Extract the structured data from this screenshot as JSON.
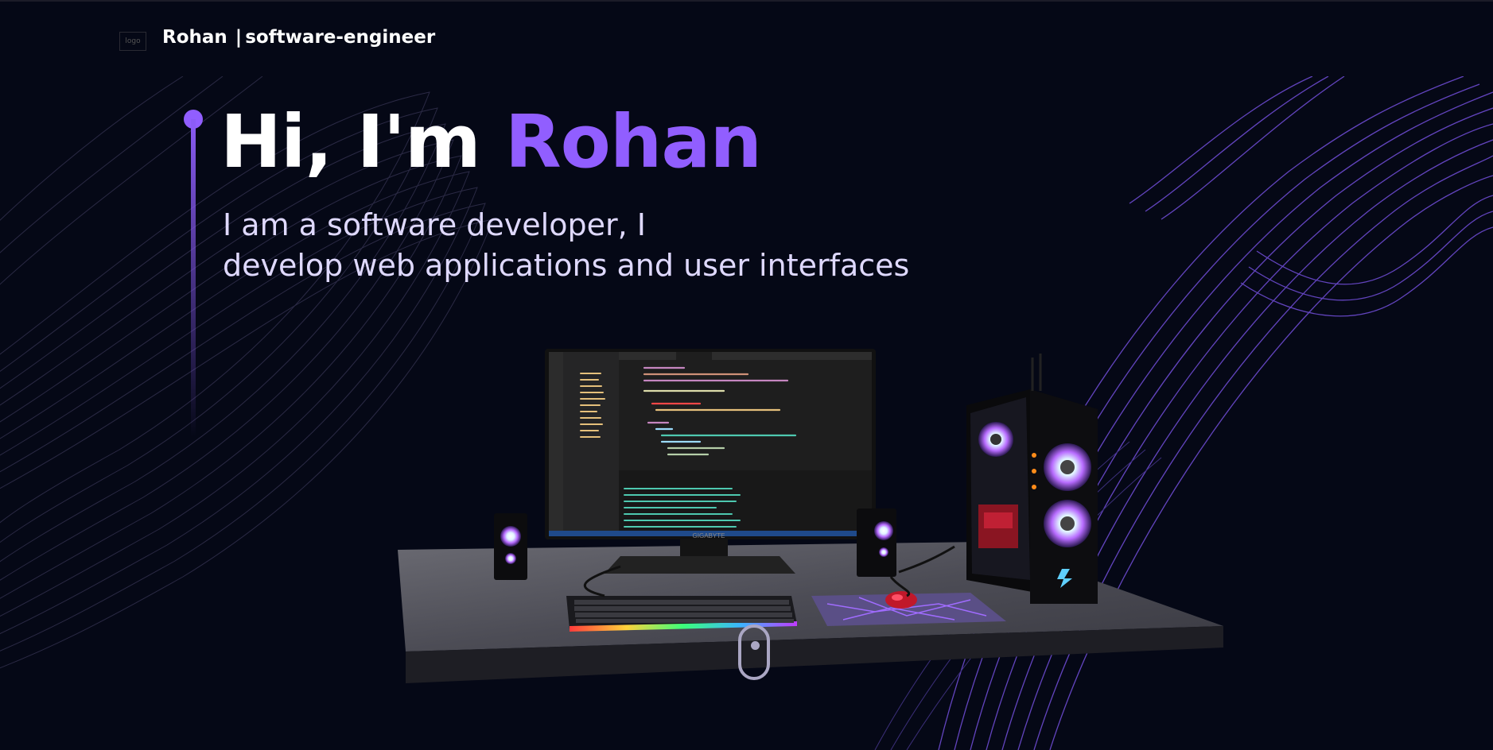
{
  "nav": {
    "logo_alt": "logo",
    "brand_name": "Rohan",
    "separator": "|",
    "brand_role": "software-engineer"
  },
  "hero": {
    "greeting": "Hi, I'm",
    "name": "Rohan",
    "tagline_line1": "I am a software developer, I",
    "tagline_line2": "develop web applications and user interfaces"
  },
  "scene": {
    "monitor_brand": "GIGABYTE"
  },
  "colors": {
    "background": "#050816",
    "accent": "#915eff",
    "tagline": "#dfd9ff"
  },
  "icons": [
    "logo-icon",
    "scroll-mouse-icon"
  ]
}
